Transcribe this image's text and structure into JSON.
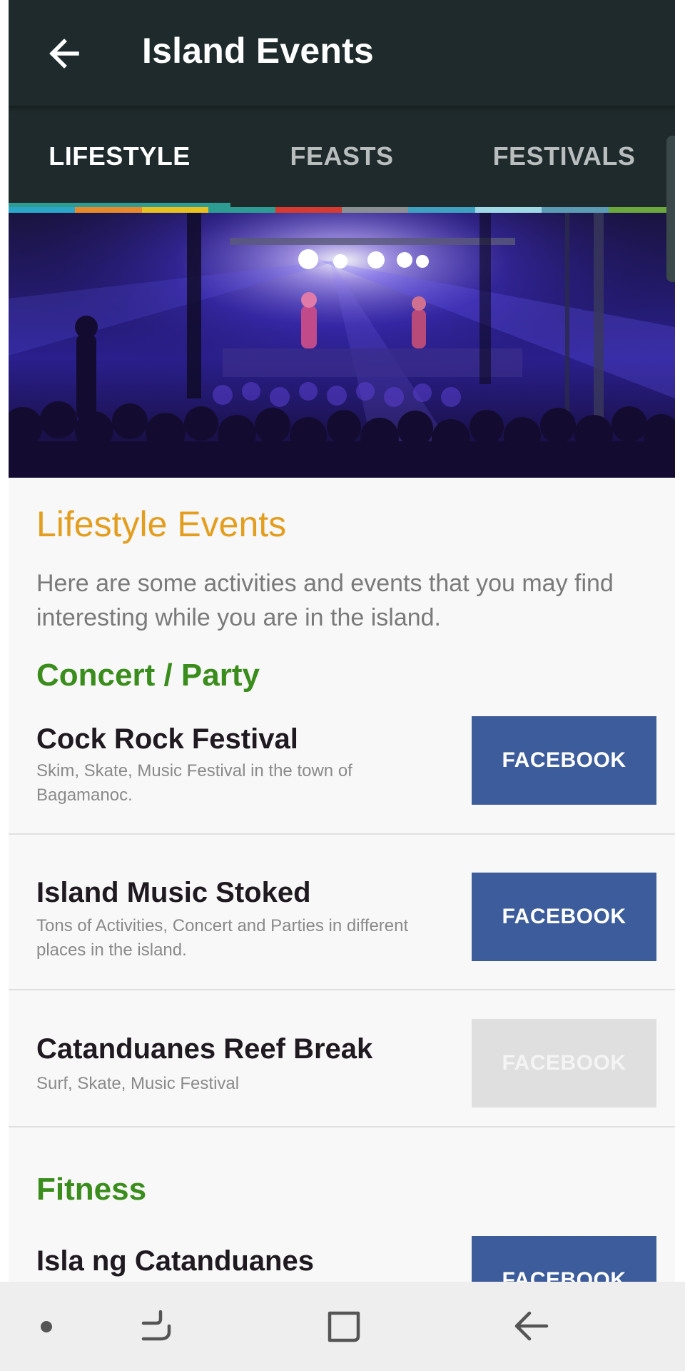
{
  "app": {
    "title": "Island Events",
    "back_icon": "arrow-left-icon"
  },
  "tabs": [
    {
      "label": "LIFESTYLE",
      "selected": true
    },
    {
      "label": "FEASTS",
      "selected": false
    },
    {
      "label": "FESTIVALS",
      "selected": false
    }
  ],
  "colors": {
    "appbar": "#1e2a2b",
    "accent_title": "#e39e1f",
    "category": "#3a8d1c",
    "facebook": "#3d5c9b",
    "facebook_disabled": "#dfdfdf",
    "stripe": [
      "#2aa6c6",
      "#e88a2c",
      "#e8c121",
      "#2e9c93",
      "#d63a30",
      "#8a8f93",
      "#3fa0c0",
      "#9fd9e6",
      "#5b9bb3",
      "#6aa83d"
    ]
  },
  "section": {
    "title": "Lifestyle Events",
    "intro": "Here are some activities and events that you may find interesting while you are in the island."
  },
  "categories": [
    {
      "title": "Concert / Party",
      "events": [
        {
          "name": "Cock Rock Festival",
          "desc": "Skim, Skate, Music Festival in the town of Bagamanoc.",
          "button": "FACEBOOK",
          "enabled": true
        },
        {
          "name": "Island Music Stoked",
          "desc": "Tons of Activities, Concert and Parties in different places in the island.",
          "button": "FACEBOOK",
          "enabled": true
        },
        {
          "name": "Catanduanes Reef Break",
          "desc": "Surf, Skate, Music Festival",
          "button": "FACEBOOK",
          "enabled": false
        }
      ]
    },
    {
      "title": "Fitness",
      "events": [
        {
          "name": "Isla ng Catanduanes Ultramarathon",
          "desc": "",
          "button": "FACEBOOK",
          "enabled": true
        }
      ]
    }
  ],
  "navbar": {
    "icons": [
      "dot-icon",
      "recent-apps-icon",
      "home-icon",
      "back-icon"
    ]
  }
}
